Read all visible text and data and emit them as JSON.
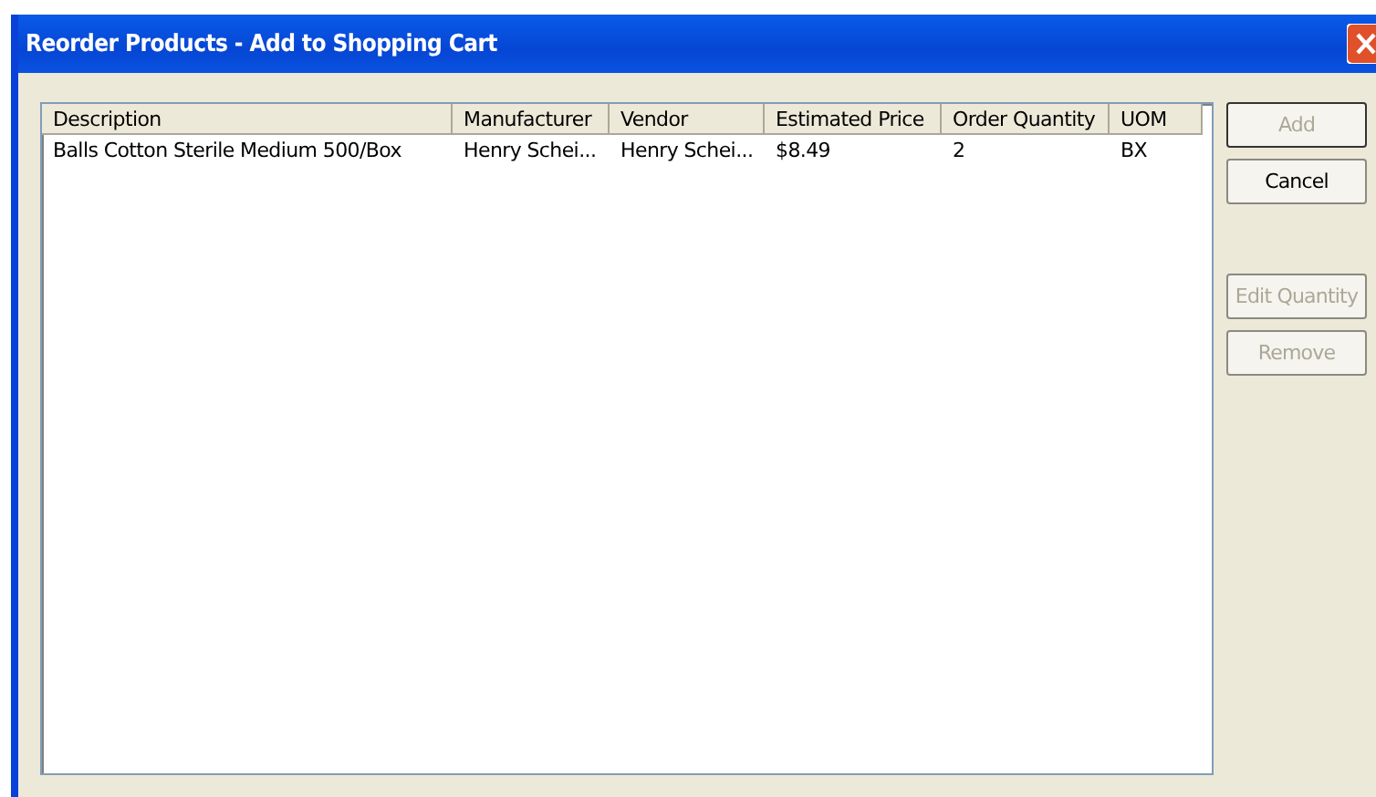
{
  "window": {
    "title": "Reorder Products - Add to Shopping Cart"
  },
  "table": {
    "columns": [
      "Description",
      "Manufacturer",
      "Vendor",
      "Estimated Price",
      "Order Quantity",
      "UOM"
    ],
    "rows": [
      [
        "Balls Cotton Sterile Medium 500/Box",
        "Henry Schei...",
        "Henry Schei...",
        "$8.49",
        "2",
        "BX"
      ]
    ]
  },
  "buttons": [
    {
      "label": "Add",
      "disabled": true
    },
    {
      "label": "Cancel",
      "disabled": false
    },
    {
      "label": "Edit Quantity",
      "disabled": true
    },
    {
      "label": "Remove",
      "disabled": true
    }
  ]
}
